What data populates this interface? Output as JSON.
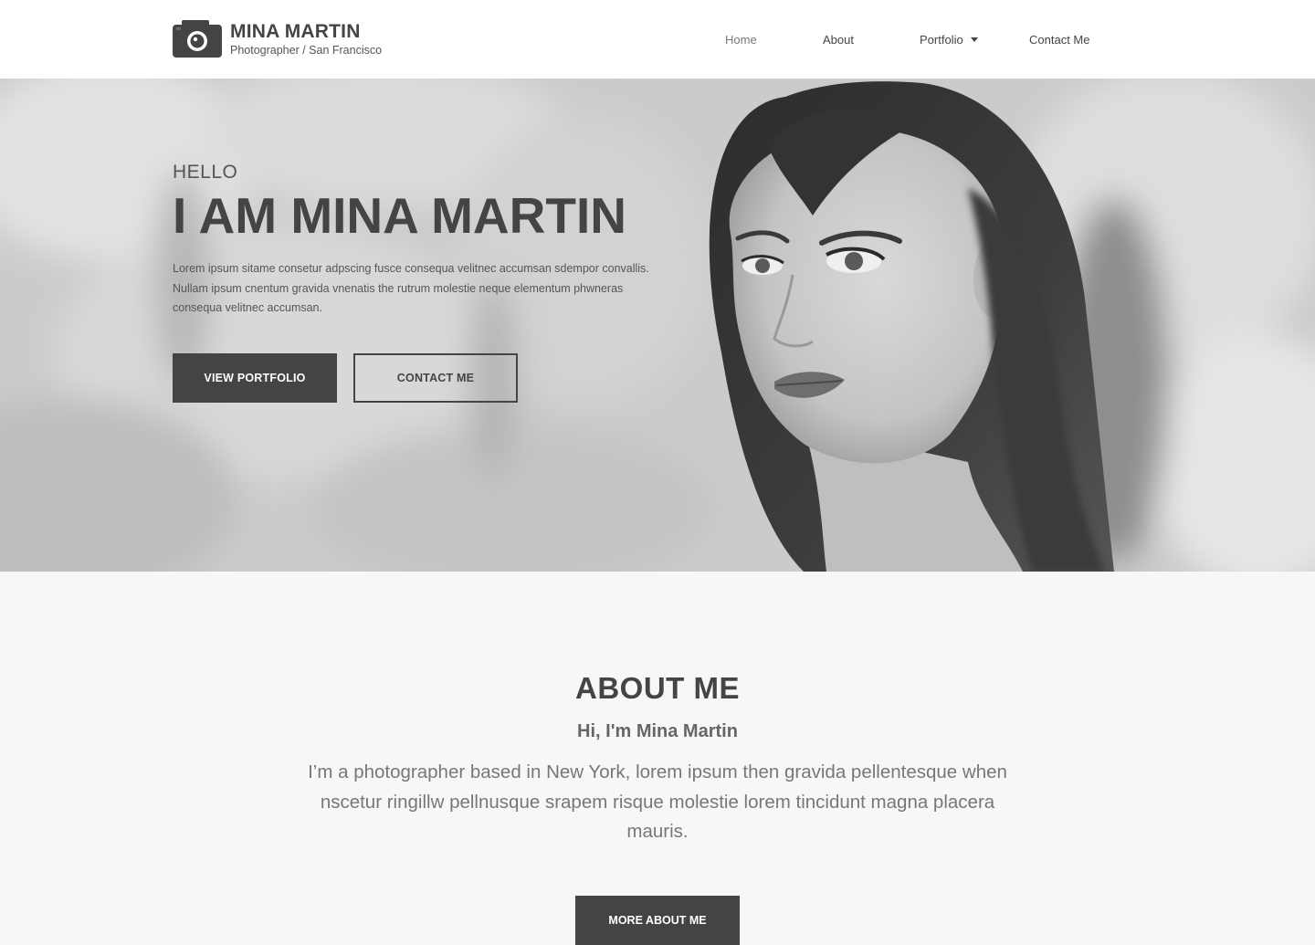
{
  "header": {
    "brand_name": "MINA MARTIN",
    "brand_tagline": "Photographer / San Francisco",
    "logo_icon": "camera-icon",
    "nav": [
      {
        "label": "Home"
      },
      {
        "label": "About"
      },
      {
        "label": "Portfolio",
        "has_dropdown": true
      },
      {
        "label": "Contact Me"
      }
    ]
  },
  "hero": {
    "greeting": "HELLO",
    "title": "I AM MINA MARTIN",
    "description": "Lorem ipsum sitame consetur adpscing fusce consequa velitnec accumsan sdempor convallis. Nullam ipsum cnentum gravida vnenatis the rutrum molestie neque elementum phwneras consequa velitnec accumsan.",
    "primary_button": "VIEW PORTFOLIO",
    "secondary_button": "CONTACT ME"
  },
  "about": {
    "title": "ABOUT ME",
    "subtitle": "Hi, I'm Mina Martin",
    "text": "I’m a photographer based in New York, lorem ipsum then gravida pellentesque when nscetur ringillw pellnusque srapem risque molestie lorem tincidunt magna placera mauris.",
    "button": "MORE ABOUT ME"
  },
  "colors": {
    "dark": "#444444",
    "background": "#f7f7f7",
    "header_bg": "#ffffff"
  }
}
